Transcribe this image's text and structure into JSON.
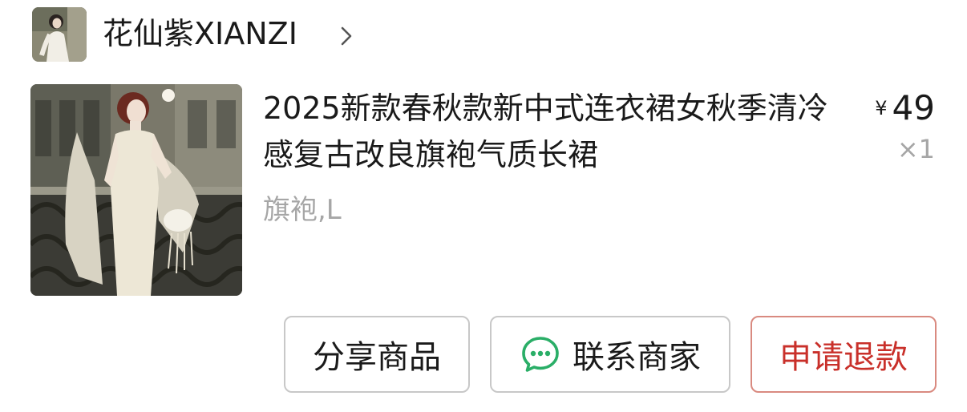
{
  "shop": {
    "name": "花仙紫XIANZI",
    "avatar_icon": "shop-avatar-photo",
    "chevron_icon": "chevron-right-icon"
  },
  "product": {
    "image_icon": "product-photo",
    "title": "2025新款春秋款新中式连衣裙女秋季清冷感复古改良旗袍气质长裙",
    "spec": "旗袍,L",
    "price_symbol": "¥",
    "price": "49",
    "quantity": "×1"
  },
  "actions": {
    "share_label": "分享商品",
    "contact_label": "联系商家",
    "contact_icon": "chat-bubble-icon",
    "refund_label": "申请退款"
  },
  "colors": {
    "text": "#1a1a1a",
    "muted": "#a6a6a6",
    "border": "#c8c8c8",
    "refund_red": "#c9302a",
    "refund_border": "#d98a80",
    "wechat_green": "#2aae67"
  }
}
